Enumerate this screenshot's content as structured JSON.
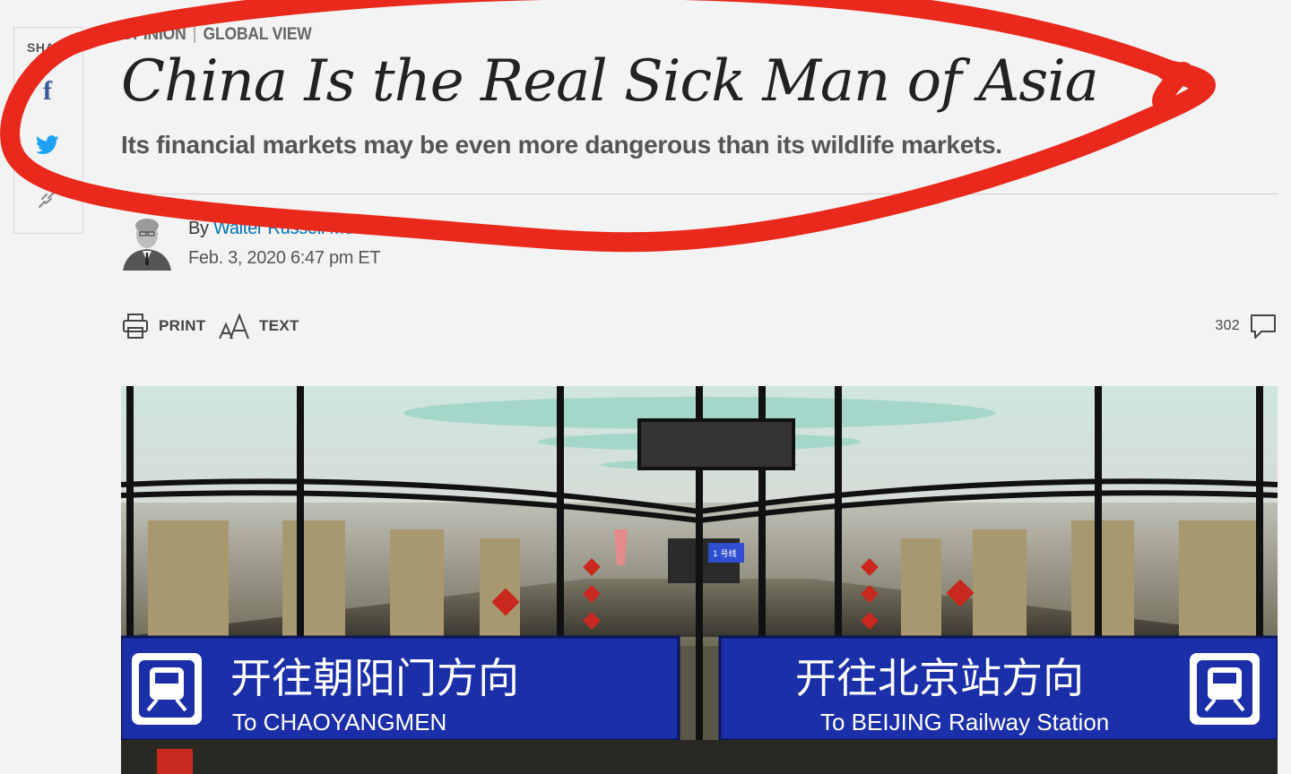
{
  "share": {
    "label": "SHARE",
    "facebook_icon": "facebook-icon",
    "twitter_icon": "twitter-icon",
    "link_icon": "link-icon"
  },
  "article": {
    "section": "OPINION",
    "column": "GLOBAL VIEW",
    "headline": "China Is the Real Sick Man of Asia",
    "dek": "Its financial markets may be even more dangerous than its wildlife markets.",
    "byline_prefix": "By",
    "author": "Walter Russell Mead",
    "timestamp": "Feb. 3, 2020 6:47 pm ET"
  },
  "toolbar": {
    "print_label": "PRINT",
    "text_label": "TEXT",
    "comment_count": "302"
  },
  "photo": {
    "sign_left_cn": "开往朝阳门方向",
    "sign_left_en": "To CHAOYANGMEN",
    "sign_right_cn": "开往北京站方向",
    "sign_right_en": "To BEIJING Railway Station",
    "screen_text": "1 号线"
  },
  "colors": {
    "background": "#f3f3f3",
    "link": "#0274b6",
    "facebook": "#3b5998",
    "twitter": "#1da1f2",
    "annotation": "#e8291c",
    "sign_blue": "#1a2fa8"
  }
}
